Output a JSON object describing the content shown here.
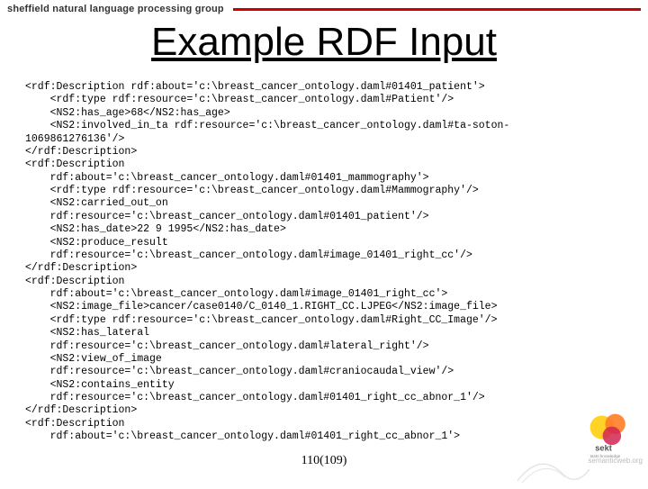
{
  "header": {
    "group": "sheffield natural language processing group"
  },
  "title": "Example RDF Input",
  "code": "<rdf:Description rdf:about='c:\\breast_cancer_ontology.daml#01401_patient'>\n    <rdf:type rdf:resource='c:\\breast_cancer_ontology.daml#Patient'/>\n    <NS2:has_age>68</NS2:has_age>\n    <NS2:involved_in_ta rdf:resource='c:\\breast_cancer_ontology.daml#ta-soton-\n1069861276136'/>\n</rdf:Description>\n<rdf:Description\n    rdf:about='c:\\breast_cancer_ontology.daml#01401_mammography'>\n    <rdf:type rdf:resource='c:\\breast_cancer_ontology.daml#Mammography'/>\n    <NS2:carried_out_on\n    rdf:resource='c:\\breast_cancer_ontology.daml#01401_patient'/>\n    <NS2:has_date>22 9 1995</NS2:has_date>\n    <NS2:produce_result\n    rdf:resource='c:\\breast_cancer_ontology.daml#image_01401_right_cc'/>\n</rdf:Description>\n<rdf:Description\n    rdf:about='c:\\breast_cancer_ontology.daml#image_01401_right_cc'>\n    <NS2:image_file>cancer/case0140/C_0140_1.RIGHT_CC.LJPEG</NS2:image_file>\n    <rdf:type rdf:resource='c:\\breast_cancer_ontology.daml#Right_CC_Image'/>\n    <NS2:has_lateral\n    rdf:resource='c:\\breast_cancer_ontology.daml#lateral_right'/>\n    <NS2:view_of_image\n    rdf:resource='c:\\breast_cancer_ontology.daml#craniocaudal_view'/>\n    <NS2:contains_entity\n    rdf:resource='c:\\breast_cancer_ontology.daml#01401_right_cc_abnor_1'/>\n</rdf:Description>\n<rdf:Description\n    rdf:about='c:\\breast_cancer_ontology.daml#01401_right_cc_abnor_1'>",
  "pagenum": "110(109)",
  "logo": {
    "label": "sekt",
    "tagline": "taste knowledge"
  },
  "footer_link": "semanticweb.org"
}
